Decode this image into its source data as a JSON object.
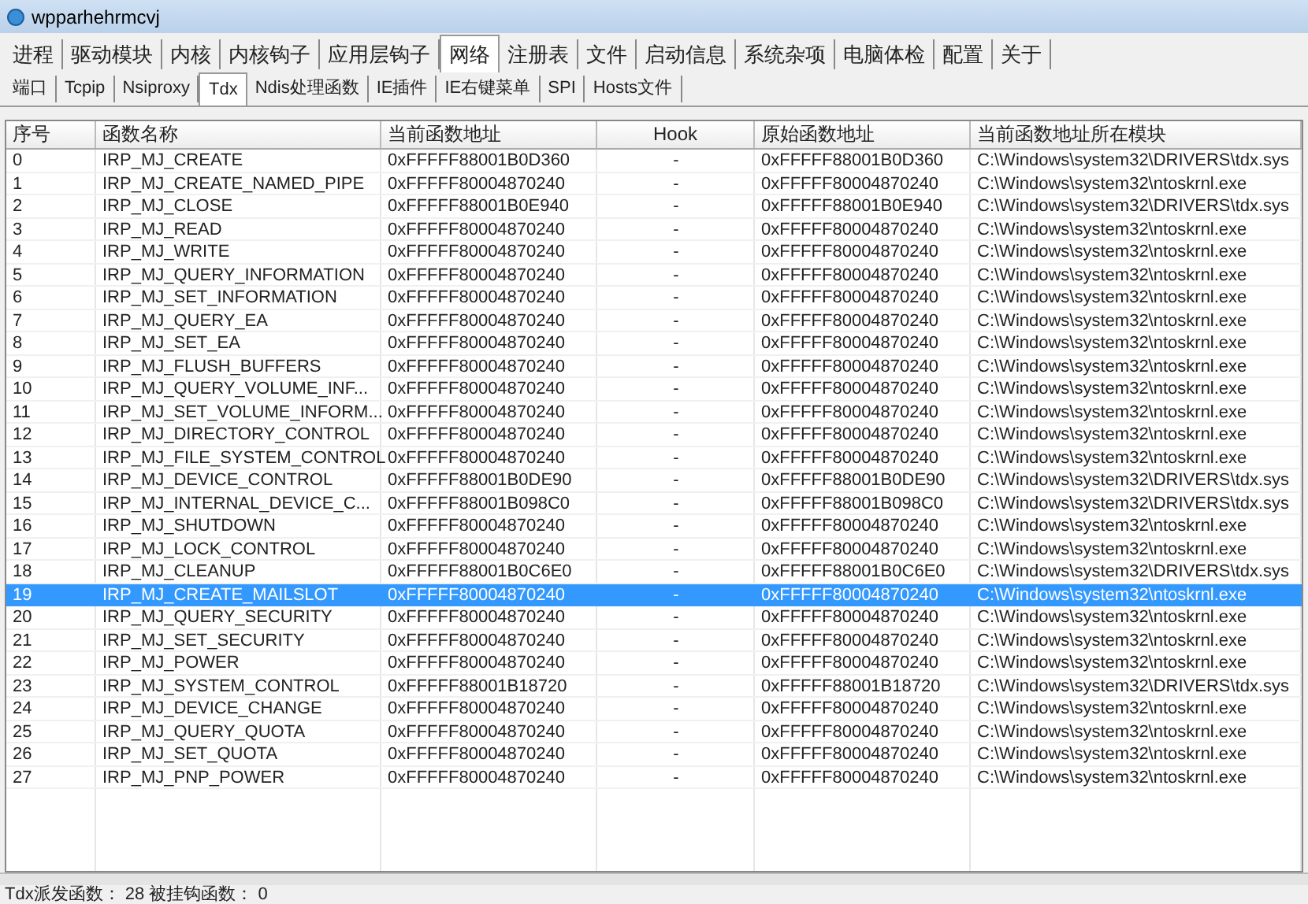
{
  "window": {
    "title": "wpparhehrmcvj"
  },
  "tabs": [
    {
      "label": "进程",
      "selected": false
    },
    {
      "label": "驱动模块",
      "selected": false
    },
    {
      "label": "内核",
      "selected": false
    },
    {
      "label": "内核钩子",
      "selected": false
    },
    {
      "label": "应用层钩子",
      "selected": false
    },
    {
      "label": "网络",
      "selected": true
    },
    {
      "label": "注册表",
      "selected": false
    },
    {
      "label": "文件",
      "selected": false
    },
    {
      "label": "启动信息",
      "selected": false
    },
    {
      "label": "系统杂项",
      "selected": false
    },
    {
      "label": "电脑体检",
      "selected": false
    },
    {
      "label": "配置",
      "selected": false
    },
    {
      "label": "关于",
      "selected": false
    }
  ],
  "subtabs": [
    {
      "label": "端口",
      "selected": false
    },
    {
      "label": "Tcpip",
      "selected": false
    },
    {
      "label": "Nsiproxy",
      "selected": false
    },
    {
      "label": "Tdx",
      "selected": true
    },
    {
      "label": "Ndis处理函数",
      "selected": false
    },
    {
      "label": "IE插件",
      "selected": false
    },
    {
      "label": "IE右键菜单",
      "selected": false
    },
    {
      "label": "SPI",
      "selected": false
    },
    {
      "label": "Hosts文件",
      "selected": false
    }
  ],
  "table": {
    "columns": [
      "序号",
      "函数名称",
      "当前函数地址",
      "Hook",
      "原始函数地址",
      "当前函数地址所在模块"
    ],
    "rows": [
      {
        "cells": [
          "0",
          "IRP_MJ_CREATE",
          "0xFFFFF88001B0D360",
          "-",
          "0xFFFFF88001B0D360",
          "C:\\Windows\\system32\\DRIVERS\\tdx.sys"
        ],
        "selected": false
      },
      {
        "cells": [
          "1",
          "IRP_MJ_CREATE_NAMED_PIPE",
          "0xFFFFF80004870240",
          "-",
          "0xFFFFF80004870240",
          "C:\\Windows\\system32\\ntoskrnl.exe"
        ],
        "selected": false
      },
      {
        "cells": [
          "2",
          "IRP_MJ_CLOSE",
          "0xFFFFF88001B0E940",
          "-",
          "0xFFFFF88001B0E940",
          "C:\\Windows\\system32\\DRIVERS\\tdx.sys"
        ],
        "selected": false
      },
      {
        "cells": [
          "3",
          "IRP_MJ_READ",
          "0xFFFFF80004870240",
          "-",
          "0xFFFFF80004870240",
          "C:\\Windows\\system32\\ntoskrnl.exe"
        ],
        "selected": false
      },
      {
        "cells": [
          "4",
          "IRP_MJ_WRITE",
          "0xFFFFF80004870240",
          "-",
          "0xFFFFF80004870240",
          "C:\\Windows\\system32\\ntoskrnl.exe"
        ],
        "selected": false
      },
      {
        "cells": [
          "5",
          "IRP_MJ_QUERY_INFORMATION",
          "0xFFFFF80004870240",
          "-",
          "0xFFFFF80004870240",
          "C:\\Windows\\system32\\ntoskrnl.exe"
        ],
        "selected": false
      },
      {
        "cells": [
          "6",
          "IRP_MJ_SET_INFORMATION",
          "0xFFFFF80004870240",
          "-",
          "0xFFFFF80004870240",
          "C:\\Windows\\system32\\ntoskrnl.exe"
        ],
        "selected": false
      },
      {
        "cells": [
          "7",
          "IRP_MJ_QUERY_EA",
          "0xFFFFF80004870240",
          "-",
          "0xFFFFF80004870240",
          "C:\\Windows\\system32\\ntoskrnl.exe"
        ],
        "selected": false
      },
      {
        "cells": [
          "8",
          "IRP_MJ_SET_EA",
          "0xFFFFF80004870240",
          "-",
          "0xFFFFF80004870240",
          "C:\\Windows\\system32\\ntoskrnl.exe"
        ],
        "selected": false
      },
      {
        "cells": [
          "9",
          "IRP_MJ_FLUSH_BUFFERS",
          "0xFFFFF80004870240",
          "-",
          "0xFFFFF80004870240",
          "C:\\Windows\\system32\\ntoskrnl.exe"
        ],
        "selected": false
      },
      {
        "cells": [
          "10",
          "IRP_MJ_QUERY_VOLUME_INF...",
          "0xFFFFF80004870240",
          "-",
          "0xFFFFF80004870240",
          "C:\\Windows\\system32\\ntoskrnl.exe"
        ],
        "selected": false
      },
      {
        "cells": [
          "11",
          "IRP_MJ_SET_VOLUME_INFORM...",
          "0xFFFFF80004870240",
          "-",
          "0xFFFFF80004870240",
          "C:\\Windows\\system32\\ntoskrnl.exe"
        ],
        "selected": false
      },
      {
        "cells": [
          "12",
          "IRP_MJ_DIRECTORY_CONTROL",
          "0xFFFFF80004870240",
          "-",
          "0xFFFFF80004870240",
          "C:\\Windows\\system32\\ntoskrnl.exe"
        ],
        "selected": false
      },
      {
        "cells": [
          "13",
          "IRP_MJ_FILE_SYSTEM_CONTROL",
          "0xFFFFF80004870240",
          "-",
          "0xFFFFF80004870240",
          "C:\\Windows\\system32\\ntoskrnl.exe"
        ],
        "selected": false
      },
      {
        "cells": [
          "14",
          "IRP_MJ_DEVICE_CONTROL",
          "0xFFFFF88001B0DE90",
          "-",
          "0xFFFFF88001B0DE90",
          "C:\\Windows\\system32\\DRIVERS\\tdx.sys"
        ],
        "selected": false
      },
      {
        "cells": [
          "15",
          "IRP_MJ_INTERNAL_DEVICE_C...",
          "0xFFFFF88001B098C0",
          "-",
          "0xFFFFF88001B098C0",
          "C:\\Windows\\system32\\DRIVERS\\tdx.sys"
        ],
        "selected": false
      },
      {
        "cells": [
          "16",
          "IRP_MJ_SHUTDOWN",
          "0xFFFFF80004870240",
          "-",
          "0xFFFFF80004870240",
          "C:\\Windows\\system32\\ntoskrnl.exe"
        ],
        "selected": false
      },
      {
        "cells": [
          "17",
          "IRP_MJ_LOCK_CONTROL",
          "0xFFFFF80004870240",
          "-",
          "0xFFFFF80004870240",
          "C:\\Windows\\system32\\ntoskrnl.exe"
        ],
        "selected": false
      },
      {
        "cells": [
          "18",
          "IRP_MJ_CLEANUP",
          "0xFFFFF88001B0C6E0",
          "-",
          "0xFFFFF88001B0C6E0",
          "C:\\Windows\\system32\\DRIVERS\\tdx.sys"
        ],
        "selected": false
      },
      {
        "cells": [
          "19",
          "IRP_MJ_CREATE_MAILSLOT",
          "0xFFFFF80004870240",
          "-",
          "0xFFFFF80004870240",
          "C:\\Windows\\system32\\ntoskrnl.exe"
        ],
        "selected": true
      },
      {
        "cells": [
          "20",
          "IRP_MJ_QUERY_SECURITY",
          "0xFFFFF80004870240",
          "-",
          "0xFFFFF80004870240",
          "C:\\Windows\\system32\\ntoskrnl.exe"
        ],
        "selected": false
      },
      {
        "cells": [
          "21",
          "IRP_MJ_SET_SECURITY",
          "0xFFFFF80004870240",
          "-",
          "0xFFFFF80004870240",
          "C:\\Windows\\system32\\ntoskrnl.exe"
        ],
        "selected": false
      },
      {
        "cells": [
          "22",
          "IRP_MJ_POWER",
          "0xFFFFF80004870240",
          "-",
          "0xFFFFF80004870240",
          "C:\\Windows\\system32\\ntoskrnl.exe"
        ],
        "selected": false
      },
      {
        "cells": [
          "23",
          "IRP_MJ_SYSTEM_CONTROL",
          "0xFFFFF88001B18720",
          "-",
          "0xFFFFF88001B18720",
          "C:\\Windows\\system32\\DRIVERS\\tdx.sys"
        ],
        "selected": false
      },
      {
        "cells": [
          "24",
          "IRP_MJ_DEVICE_CHANGE",
          "0xFFFFF80004870240",
          "-",
          "0xFFFFF80004870240",
          "C:\\Windows\\system32\\ntoskrnl.exe"
        ],
        "selected": false
      },
      {
        "cells": [
          "25",
          "IRP_MJ_QUERY_QUOTA",
          "0xFFFFF80004870240",
          "-",
          "0xFFFFF80004870240",
          "C:\\Windows\\system32\\ntoskrnl.exe"
        ],
        "selected": false
      },
      {
        "cells": [
          "26",
          "IRP_MJ_SET_QUOTA",
          "0xFFFFF80004870240",
          "-",
          "0xFFFFF80004870240",
          "C:\\Windows\\system32\\ntoskrnl.exe"
        ],
        "selected": false
      },
      {
        "cells": [
          "27",
          "IRP_MJ_PNP_POWER",
          "0xFFFFF80004870240",
          "-",
          "0xFFFFF80004870240",
          "C:\\Windows\\system32\\ntoskrnl.exe"
        ],
        "selected": false
      }
    ]
  },
  "status_bar": "Tdx派发函数： 28 被挂钩函数： 0"
}
